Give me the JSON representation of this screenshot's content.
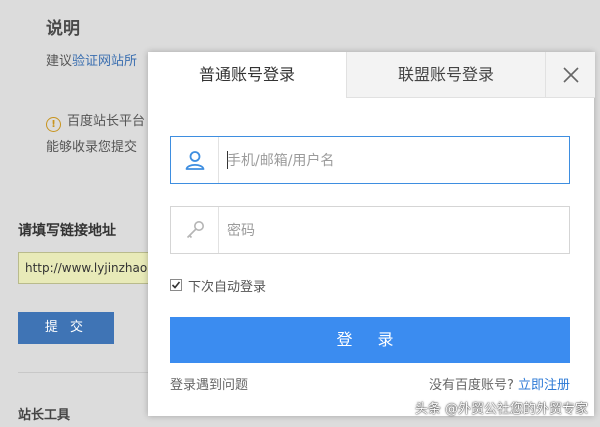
{
  "background": {
    "note_title": "说明",
    "line1_prefix": "建议",
    "line1_link": "验证网站所",
    "warn_text": "百度站长平台",
    "line3_text": "能够收录您提交",
    "link_label": "请填写链接地址",
    "url_value": "http://www.lyjinzhao",
    "submit_label": "提 交",
    "tools_label": "站长工具"
  },
  "modal": {
    "tabs": [
      {
        "label": "普通账号登录",
        "active": true
      },
      {
        "label": "联盟账号登录",
        "active": false
      }
    ],
    "close_icon": "close-icon",
    "username_placeholder": "手机/邮箱/用户名",
    "password_placeholder": "密码",
    "remember_label": "下次自动登录",
    "remember_checked": true,
    "login_label": "登 录",
    "help_link": "登录遇到问题",
    "no_account_text": "没有百度账号?",
    "register_link": "立即注册"
  },
  "watermark": "头条 @外贸公社您的外贸专家",
  "colors": {
    "primary": "#3b8cf0",
    "focus_border": "#3e8ee0",
    "link": "#2d7ad6"
  }
}
